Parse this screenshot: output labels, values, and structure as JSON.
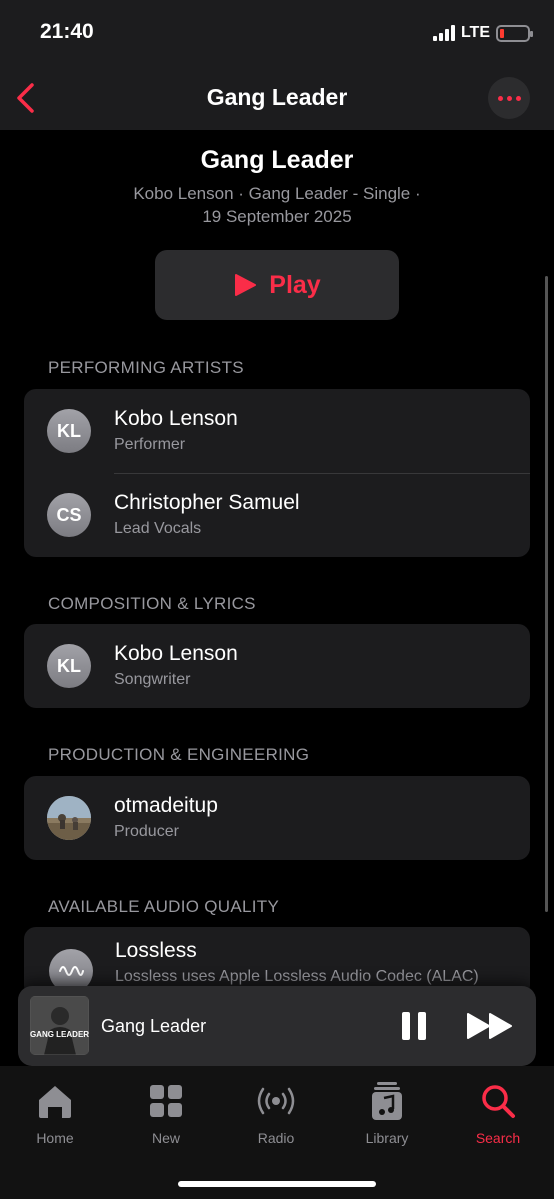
{
  "status_bar": {
    "time": "21:40",
    "network": "LTE",
    "battery_level": 0.1
  },
  "nav": {
    "title": "Gang Leader",
    "back_icon": "chevron-left-icon",
    "more_icon": "ellipsis-icon"
  },
  "header": {
    "title": "Gang Leader",
    "subtitle_line1": "Kobo Lenson · Gang Leader - Single ·",
    "subtitle_line2": "19 September 2025"
  },
  "play_button": {
    "label": "Play",
    "icon": "play-icon"
  },
  "sections": {
    "performing": {
      "title": "PERFORMING ARTISTS",
      "rows": [
        {
          "initials": "KL",
          "name": "Kobo Lenson",
          "role": "Performer"
        },
        {
          "initials": "CS",
          "name": "Christopher Samuel",
          "role": "Lead Vocals"
        }
      ]
    },
    "composition": {
      "title": "COMPOSITION & LYRICS",
      "rows": [
        {
          "initials": "KL",
          "name": "Kobo Lenson",
          "role": "Songwriter"
        }
      ]
    },
    "production": {
      "title": "PRODUCTION & ENGINEERING",
      "rows": [
        {
          "name": "otmadeitup",
          "role": "Producer"
        }
      ]
    },
    "audio_quality": {
      "title": "AVAILABLE AUDIO QUALITY",
      "rows": [
        {
          "name": "Lossless",
          "role": "Lossless uses Apple Lossless Audio Codec (ALAC)",
          "icon": "lossless-icon"
        }
      ]
    }
  },
  "mini_player": {
    "title": "Gang Leader",
    "art_text": "GANG LEADER",
    "pause_icon": "pause-icon",
    "forward_icon": "fast-forward-icon"
  },
  "tabs": [
    {
      "label": "Home",
      "icon": "home-icon"
    },
    {
      "label": "New",
      "icon": "grid-icon"
    },
    {
      "label": "Radio",
      "icon": "radio-icon"
    },
    {
      "label": "Library",
      "icon": "library-icon"
    },
    {
      "label": "Search",
      "icon": "search-icon",
      "active": true
    }
  ],
  "colors": {
    "accent": "#fa2d48",
    "background": "#000000",
    "card": "#1c1c1e",
    "secondary_text": "#98989e"
  }
}
